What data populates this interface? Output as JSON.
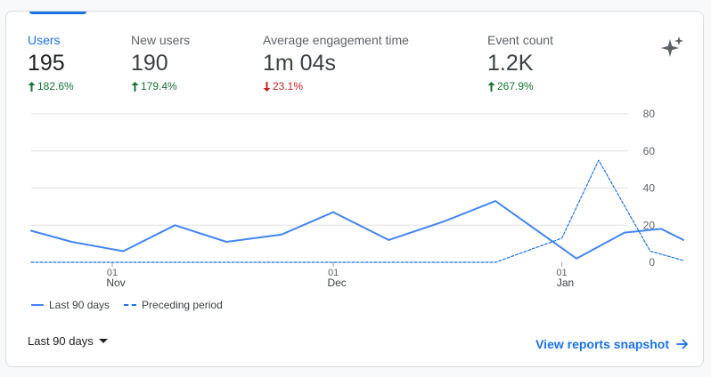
{
  "metrics": [
    {
      "label": "Users",
      "value": "195",
      "delta": "182.6%",
      "direction": "up"
    },
    {
      "label": "New users",
      "value": "190",
      "delta": "179.4%",
      "direction": "up"
    },
    {
      "label": "Average engagement time",
      "value": "1m 04s",
      "delta": "23.1%",
      "direction": "down"
    },
    {
      "label": "Event count",
      "value": "1.2K",
      "delta": "267.9%",
      "direction": "up"
    }
  ],
  "icons": {
    "insights": "sparkle-icon",
    "trend_up": "arrow-up-icon",
    "trend_down": "arrow-down-icon",
    "link": "arrow-right-icon",
    "dropdown": "caret-down-icon"
  },
  "colors": {
    "accent": "#1a73e8",
    "series_current": "#4285f4",
    "series_previous": "#1a73e8",
    "positive": "#137333",
    "negative": "#c5221f",
    "grid": "#e0e0e0"
  },
  "legend": {
    "current": "Last 90 days",
    "previous": "Preceding period"
  },
  "footer": {
    "range_label": "Last 90 days",
    "link_label": "View reports snapshot"
  },
  "chart_data": {
    "type": "line",
    "ylim": [
      0,
      80
    ],
    "yticks": [
      0,
      20,
      40,
      60,
      80
    ],
    "y_axis_position": "right",
    "grid": true,
    "x_domain": [
      0,
      81
    ],
    "x_ticks": [
      {
        "x": 11,
        "day": "01",
        "month": "Nov"
      },
      {
        "x": 41,
        "day": "01",
        "month": "Dec"
      },
      {
        "x": 72,
        "day": "01",
        "month": "Jan"
      }
    ],
    "series": [
      {
        "name": "Last 90 days",
        "style": "solid",
        "x": [
          0,
          5.5,
          12.5,
          19.5,
          26.5,
          34,
          41,
          48.5,
          56,
          63,
          74,
          80.5,
          85.5,
          92
        ],
        "y": [
          17,
          11,
          6,
          20,
          11,
          15,
          27,
          12,
          22,
          33,
          2,
          16,
          18,
          12
        ]
      },
      {
        "name": "Preceding period",
        "style": "dashed",
        "x": [
          0,
          48,
          63,
          72,
          77,
          84,
          92
        ],
        "y": [
          0,
          0,
          0,
          13,
          55,
          6,
          1
        ]
      }
    ]
  }
}
